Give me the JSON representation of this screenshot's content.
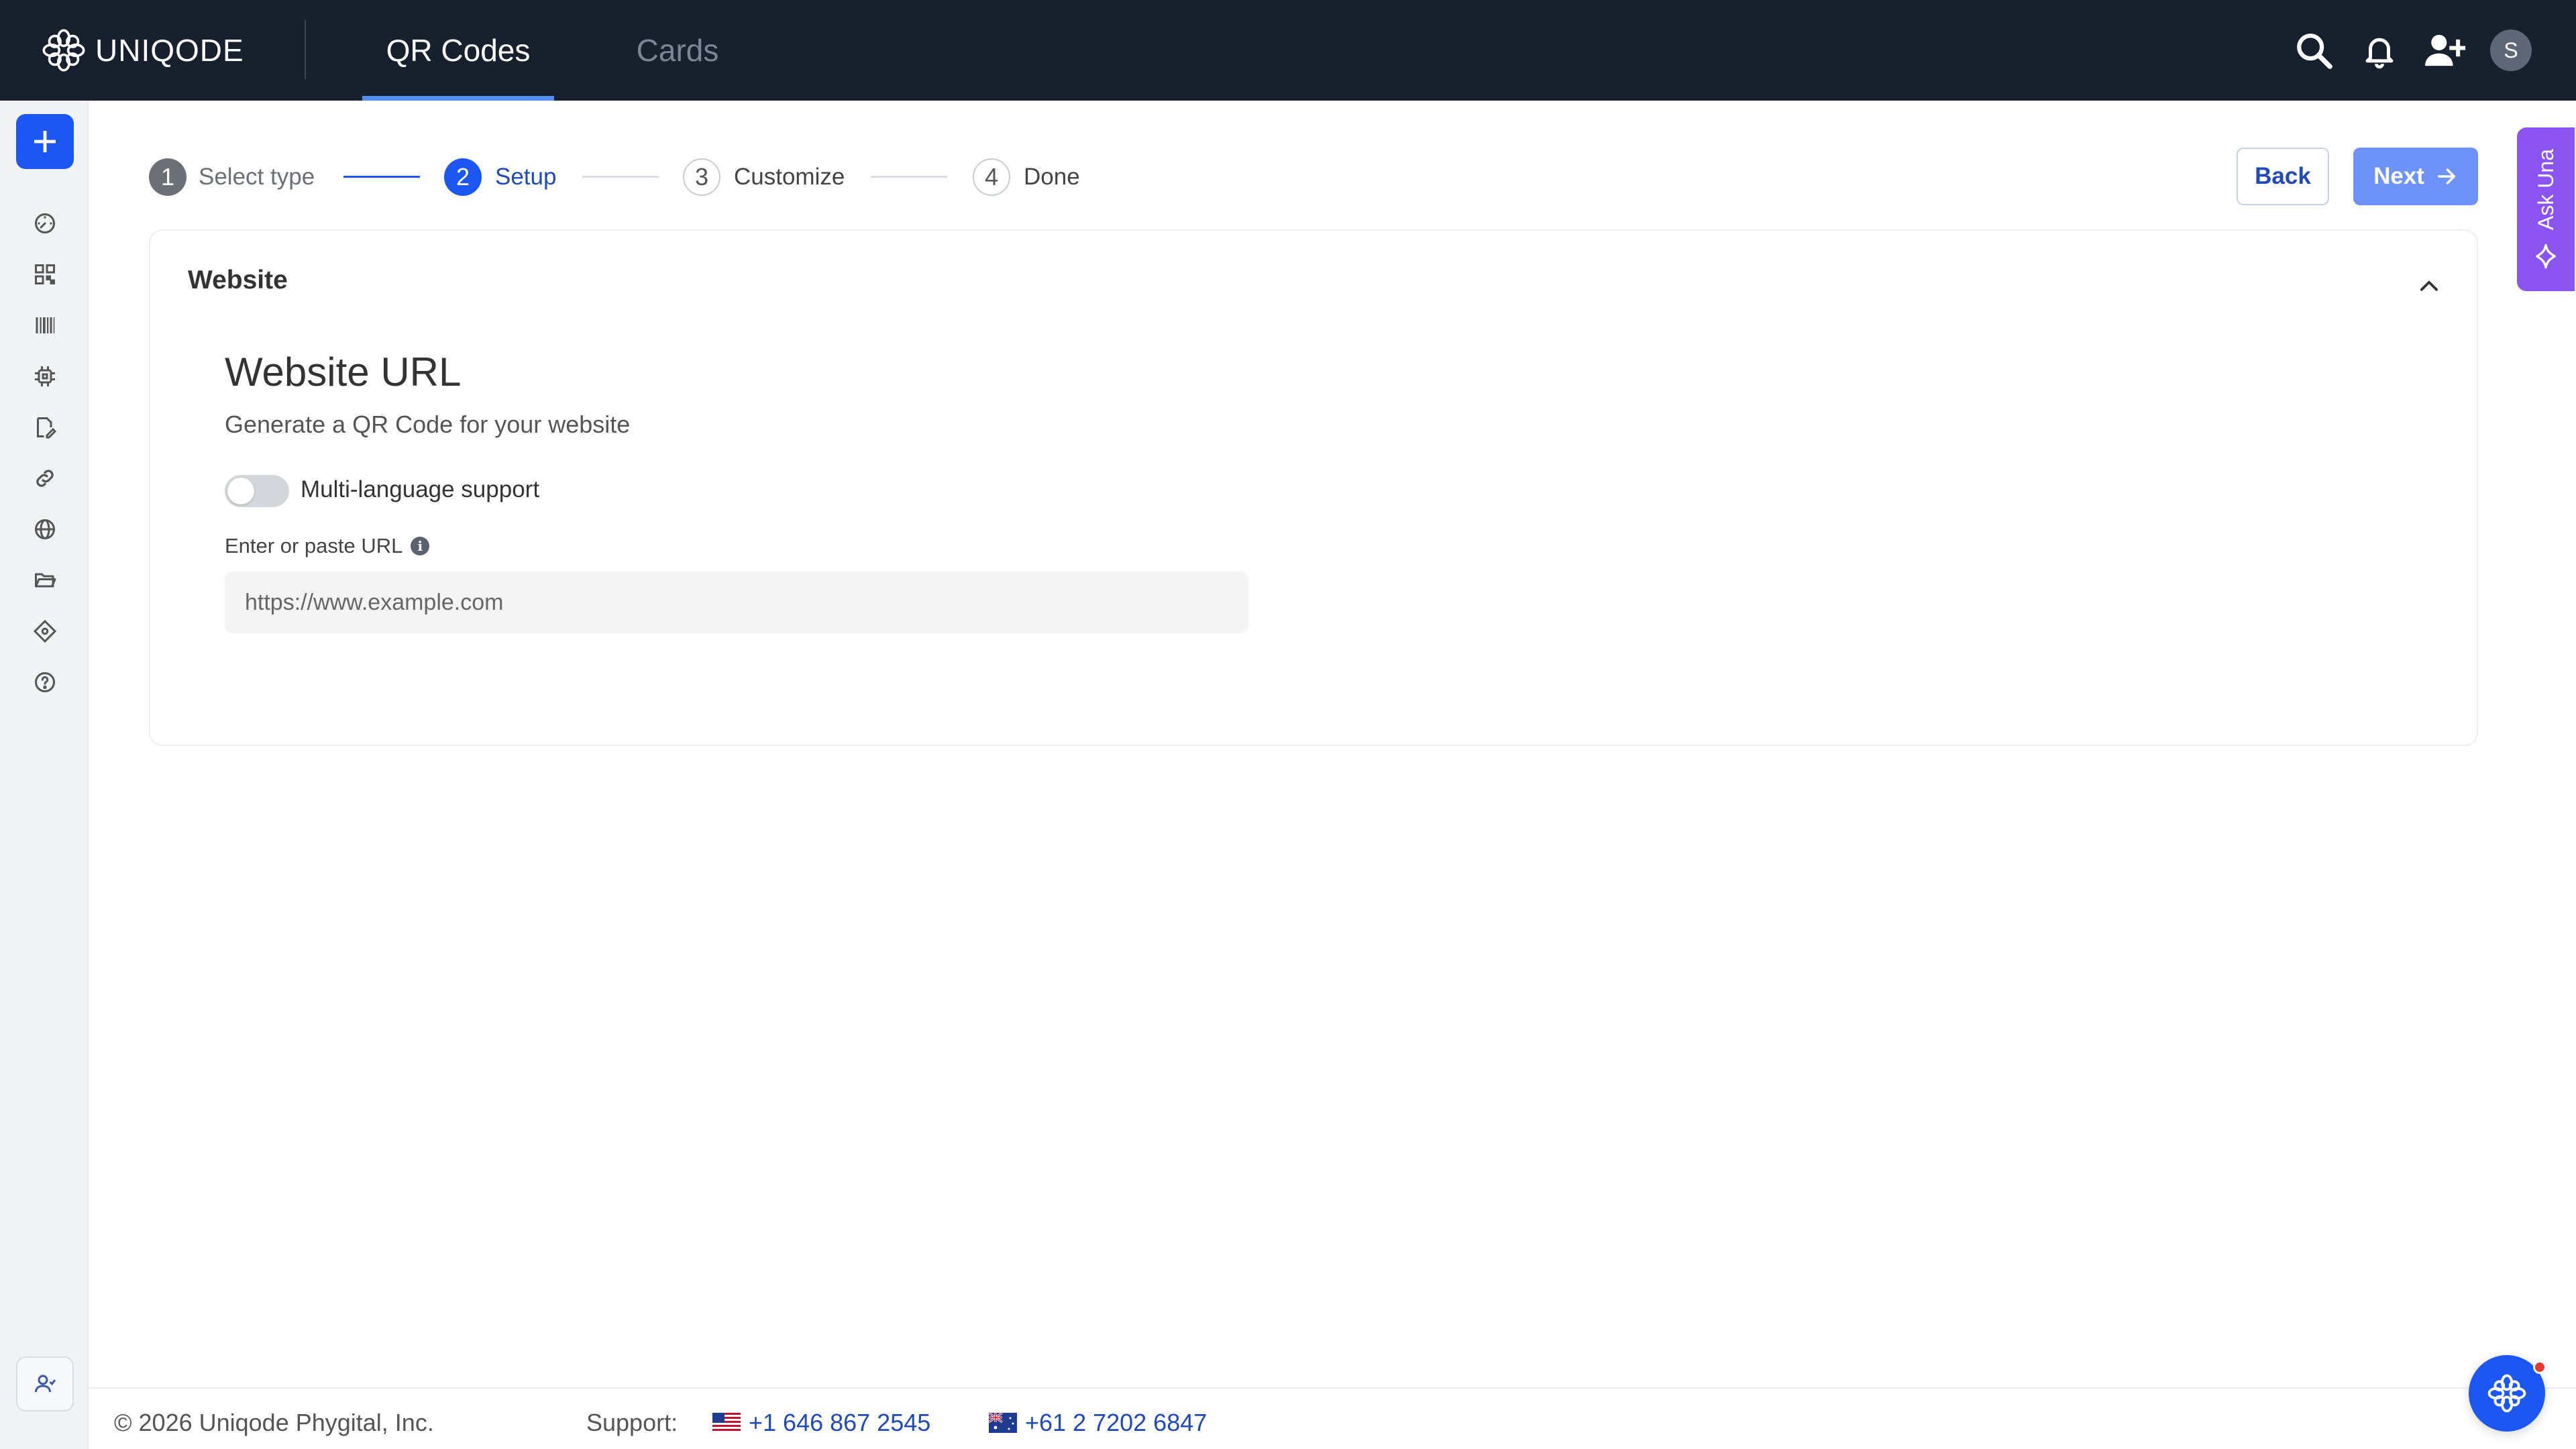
{
  "brand": {
    "name": "UNIQODE"
  },
  "nav": {
    "tabs": [
      {
        "label": "QR Codes",
        "active": true
      },
      {
        "label": "Cards",
        "active": false
      }
    ]
  },
  "header_icons": [
    "search-icon",
    "bell-icon",
    "add-user-icon"
  ],
  "user": {
    "avatar_initial": "S"
  },
  "sidebar": {
    "create_icon": "plus-icon",
    "items": [
      "dashboard-icon",
      "qr-code-icon",
      "barcode-icon",
      "chip-icon",
      "document-edit-icon",
      "link-icon",
      "globe-icon",
      "folder-icon",
      "tag-icon",
      "help-icon"
    ],
    "bottom_icon": "team-icon"
  },
  "stepper": {
    "steps": [
      {
        "number": "1",
        "label": "Select type",
        "state": "done"
      },
      {
        "number": "2",
        "label": "Setup",
        "state": "active"
      },
      {
        "number": "3",
        "label": "Customize",
        "state": "pending"
      },
      {
        "number": "4",
        "label": "Done",
        "state": "pending"
      }
    ]
  },
  "actions": {
    "back_label": "Back",
    "next_label": "Next"
  },
  "ask_una": {
    "label": "Ask Una"
  },
  "card": {
    "title": "Website",
    "section_title": "Website URL",
    "section_subtitle": "Generate a QR Code for your website",
    "toggle_label": "Multi-language support",
    "toggle_on": false,
    "url_field": {
      "label": "Enter or paste URL",
      "placeholder": "https://www.example.com",
      "value": ""
    }
  },
  "footer": {
    "copyright": "© 2026 Uniqode Phygital, Inc.",
    "support_label": "Support:",
    "phones": [
      {
        "country": "US",
        "number": "+1 646 867 2545"
      },
      {
        "country": "AU",
        "number": "+61 2 7202 6847"
      }
    ]
  },
  "colors": {
    "topbar": "#17212e",
    "primary": "#1c57f4",
    "next_button": "#6d93f8",
    "ask_una": "#8b53f0",
    "link": "#1f4ab8"
  }
}
